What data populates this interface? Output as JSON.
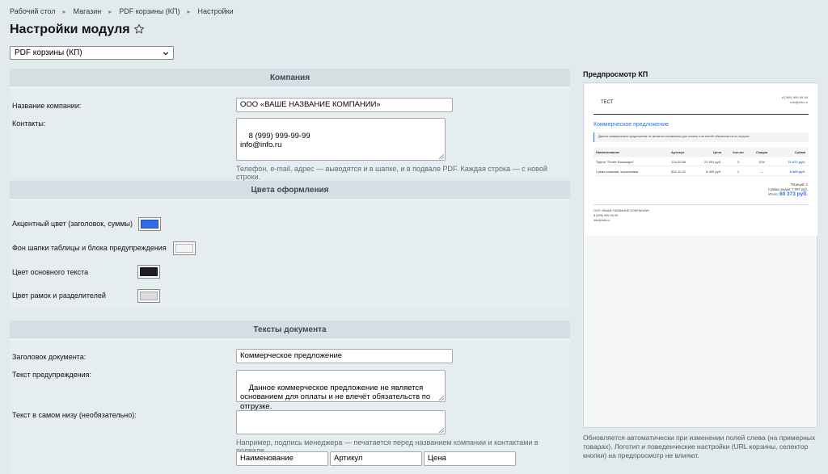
{
  "breadcrumbs": [
    "Рабочий стол",
    "Магазин",
    "PDF корзины (КП)",
    "Настройки"
  ],
  "page": {
    "title": "Настройки модуля"
  },
  "module_select": {
    "value": "PDF корзины (КП)"
  },
  "sections": {
    "company": "Компания",
    "colors": "Цвета оформления",
    "texts": "Тексты документа"
  },
  "company": {
    "name_label": "Название компании:",
    "name_value": "ООО «ВАШЕ НАЗВАНИЕ КОМПАНИИ»",
    "contacts_label": "Контакты:",
    "contacts_value": "8 (999) 999-99-99\ninfo@info.ru",
    "contacts_hint": "Телефон, e-mail, адрес — выводятся и в шапке, и в подвале PDF. Каждая строка — с новой строки."
  },
  "colors": {
    "accent_label": "Акцентный цвет (заголовок, суммы)",
    "accent": "#2f6ee8",
    "header_bg_label": "Фон шапки таблицы и блока предупреждения",
    "header_bg": "#f4f4f4",
    "text_label": "Цвет основного текста",
    "text": "#1d1d1d",
    "border_label": "Цвет рамок и разделителей",
    "border": "#dcdcdc"
  },
  "texts": {
    "doc_title_label": "Заголовок документа:",
    "doc_title_value": "Коммерческое предложение",
    "warning_label": "Текст предупреждения:",
    "warning_value": "Данное коммерческое предложение не является основанием для оплаты и не влечёт обязательств по отгрузке.",
    "footer_label": "Текст в самом низу (необязательно):",
    "footer_value": "",
    "footer_hint": "Например, подпись менеджера — печатается перед названием компании и контактами в подвале.",
    "columns": [
      "Наименование",
      "Артикул",
      "Цена"
    ]
  },
  "preview": {
    "title": "Предпросмотр КП",
    "logo_text": "ТЕСТ",
    "header_contacts": [
      "8 (999) 999-99-99",
      "info@info.ru"
    ],
    "doc_title": "Коммерческое предложение",
    "warning": "Данное коммерческое предложение не является основанием для оплаты и не влечёт обязательств по отгрузке.",
    "table_headers": [
      "Наименование",
      "Артикул",
      "Цена",
      "Кол-во",
      "Скидка",
      "Сумма"
    ],
    "rows": [
      [
        "Туфли \"Попёт Бальмари\"",
        "174-20-06",
        "23 991 руб.",
        "3",
        "10%",
        "71 872 руб."
      ],
      [
        "Сумка кожаная, коричневая",
        "502-11-02",
        "8 400 руб.",
        "1",
        "—",
        "8 400 руб."
      ]
    ],
    "positions": "Позиций: 2",
    "discount_sum": "Сумма скидки: 7 997 руб.",
    "total_label": "Итого:",
    "total_value": "80 373 руб.",
    "footer_company": "ООО «ВАШЕ НАЗВАНИЕ КОМПАНИИ»",
    "footer_phone": "8 (999) 999-99-99",
    "footer_email": "info@info.ru",
    "note": "Обновляется автоматически при изменении полей слева (на примерных товарах). Логотип и поведенческие настройки (URL корзины, селектор кнопки) на предпросмотр не влияют."
  }
}
